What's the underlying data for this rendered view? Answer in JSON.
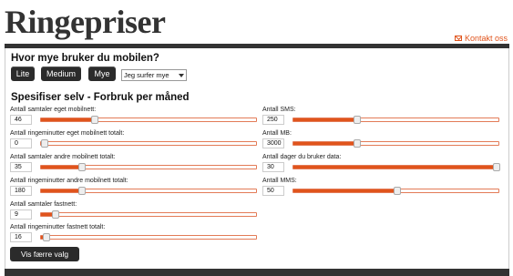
{
  "header": {
    "title": "Ringepriser",
    "contact_label": "Kontakt oss"
  },
  "usage": {
    "heading": "Hvor mye bruker du mobilen?",
    "buttons": [
      "Lite",
      "Medium",
      "Mye"
    ],
    "select_value": "Jeg surfer mye"
  },
  "custom": {
    "heading": "Spesifiser selv - Forbruk per måned",
    "left_fields": [
      {
        "label": "Antall samtaler eget mobilnett:",
        "value": "46",
        "level": 0.24
      },
      {
        "label": "Antall ringeminutter eget mobilnett totalt:",
        "value": "0",
        "level": 0.0
      },
      {
        "label": "Antall samtaler andre mobilnett totalt:",
        "value": "35",
        "level": 0.18
      },
      {
        "label": "Antall ringeminutter andre mobilnett totalt:",
        "value": "180",
        "level": 0.18
      },
      {
        "label": "Antall samtaler fastnett:",
        "value": "9",
        "level": 0.05
      },
      {
        "label": "Antall ringeminutter fastnett totalt:",
        "value": "16",
        "level": 0.01
      }
    ],
    "right_fields": [
      {
        "label": "Antall SMS:",
        "value": "250",
        "level": 0.3
      },
      {
        "label": "Antall MB:",
        "value": "3000",
        "level": 0.3
      },
      {
        "label": "Antall dager du bruker data:",
        "value": "30",
        "level": 1.0
      },
      {
        "label": "Antall MMS:",
        "value": "50",
        "level": 0.5
      }
    ]
  },
  "footer": {
    "fewer_button": "Vis færre valg"
  },
  "colors": {
    "accent": "#e0541c",
    "button_bg": "#2b2b2b"
  }
}
